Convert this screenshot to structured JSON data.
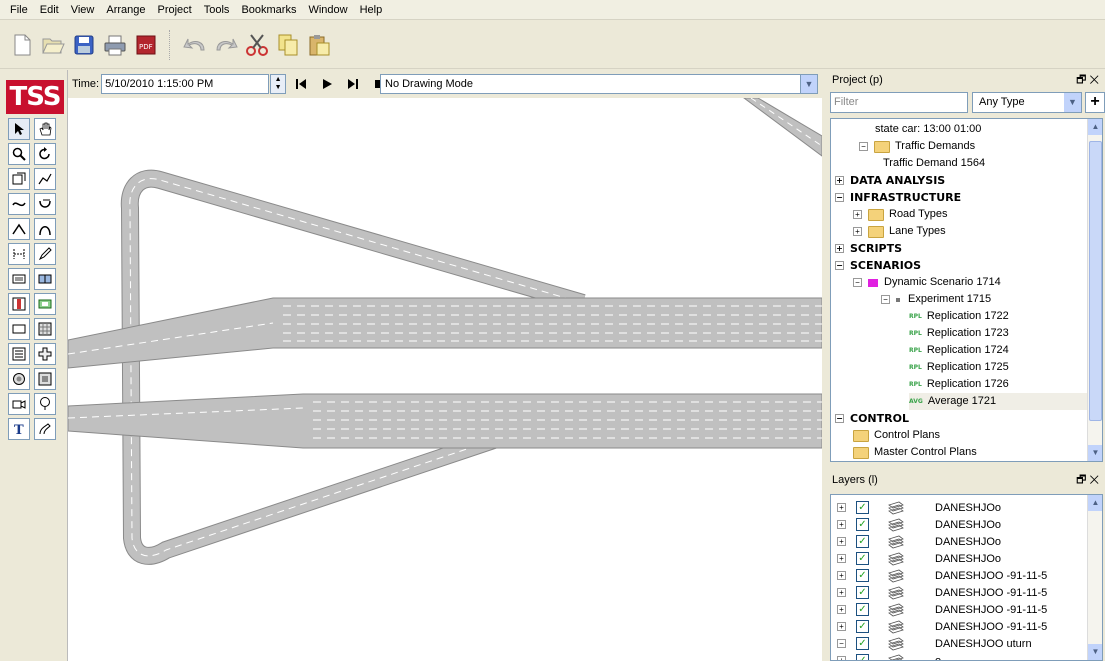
{
  "menu": [
    "File",
    "Edit",
    "View",
    "Arrange",
    "Project",
    "Tools",
    "Bookmarks",
    "Window",
    "Help"
  ],
  "toolbar": {
    "buttons": [
      "new-icon",
      "open-icon",
      "save-icon",
      "print-icon",
      "pdf-icon",
      "undo-icon",
      "redo-icon",
      "cut-icon",
      "copy-icon",
      "paste-icon"
    ]
  },
  "logo": "TSS",
  "tools": [
    "select-arrow-icon",
    "pan-hand-icon",
    "zoom-icon",
    "rotate-icon",
    "section-icon",
    "polyline-icon",
    "curve-icon",
    "turn-icon",
    "arc-icon",
    "bezier-icon",
    "node-icon",
    "pen-icon",
    "detector-icon",
    "metering-icon",
    "signal-icon",
    "vms-icon",
    "centroid-icon",
    "grid-icon",
    "block-icon",
    "add-block-icon",
    "circle-icon",
    "square-icon",
    "camera-icon",
    "balloon-icon",
    "text-icon",
    "hook-icon"
  ],
  "timebar": {
    "label": "Time:",
    "time_value": "5/10/2010 1:15:00 PM",
    "mode": "No Drawing Mode"
  },
  "project_panel": {
    "title": "Project (p)",
    "filter_placeholder": "Filter",
    "type_filter": "Any Type",
    "tree": [
      {
        "label": "state car: 13:00 01:00",
        "level": 3,
        "bold": false
      },
      {
        "label": "Traffic Demands",
        "level": 2,
        "bold": false
      },
      {
        "label": "Traffic Demand 1564",
        "level": 3,
        "bold": false
      },
      {
        "label": "DATA ANALYSIS",
        "level": 0,
        "bold": true
      },
      {
        "label": "INFRASTRUCTURE",
        "level": 0,
        "bold": true
      },
      {
        "label": "Road Types",
        "level": 1,
        "bold": false
      },
      {
        "label": "Lane Types",
        "level": 1,
        "bold": false
      },
      {
        "label": "SCRIPTS",
        "level": 0,
        "bold": true
      },
      {
        "label": "SCENARIOS",
        "level": 0,
        "bold": true
      },
      {
        "label": "Dynamic Scenario 1714",
        "level": 1,
        "bold": false
      },
      {
        "label": "Experiment 1715",
        "level": 2,
        "bold": false
      },
      {
        "label": "Replication 1722",
        "level": 3,
        "bold": false,
        "tag": "RPL"
      },
      {
        "label": "Replication 1723",
        "level": 3,
        "bold": false,
        "tag": "RPL"
      },
      {
        "label": "Replication 1724",
        "level": 3,
        "bold": false,
        "tag": "RPL"
      },
      {
        "label": "Replication 1725",
        "level": 3,
        "bold": false,
        "tag": "RPL"
      },
      {
        "label": "Replication 1726",
        "level": 3,
        "bold": false,
        "tag": "RPL"
      },
      {
        "label": "Average 1721",
        "level": 3,
        "bold": false,
        "tag": "AVG"
      },
      {
        "label": "CONTROL",
        "level": 0,
        "bold": true
      },
      {
        "label": "Control Plans",
        "level": 1,
        "bold": false
      },
      {
        "label": "Master Control Plans",
        "level": 1,
        "bold": false
      }
    ]
  },
  "layers_panel": {
    "title": "Layers (l)",
    "layers": [
      "DANESHJOo",
      "DANESHJOo",
      "DANESHJOo",
      "DANESHJOo",
      "DANESHJOO -91-11-5",
      "DANESHJOO -91-11-5",
      "DANESHJOO -91-11-5",
      "DANESHJOO -91-11-5",
      "DANESHJOO uturn",
      "o"
    ]
  },
  "colors": {
    "road_fill": "#c0c0c0",
    "road_edge": "#8a8a8a",
    "logo_red": "#c8102e",
    "scenario_icon": "#e020e0"
  }
}
